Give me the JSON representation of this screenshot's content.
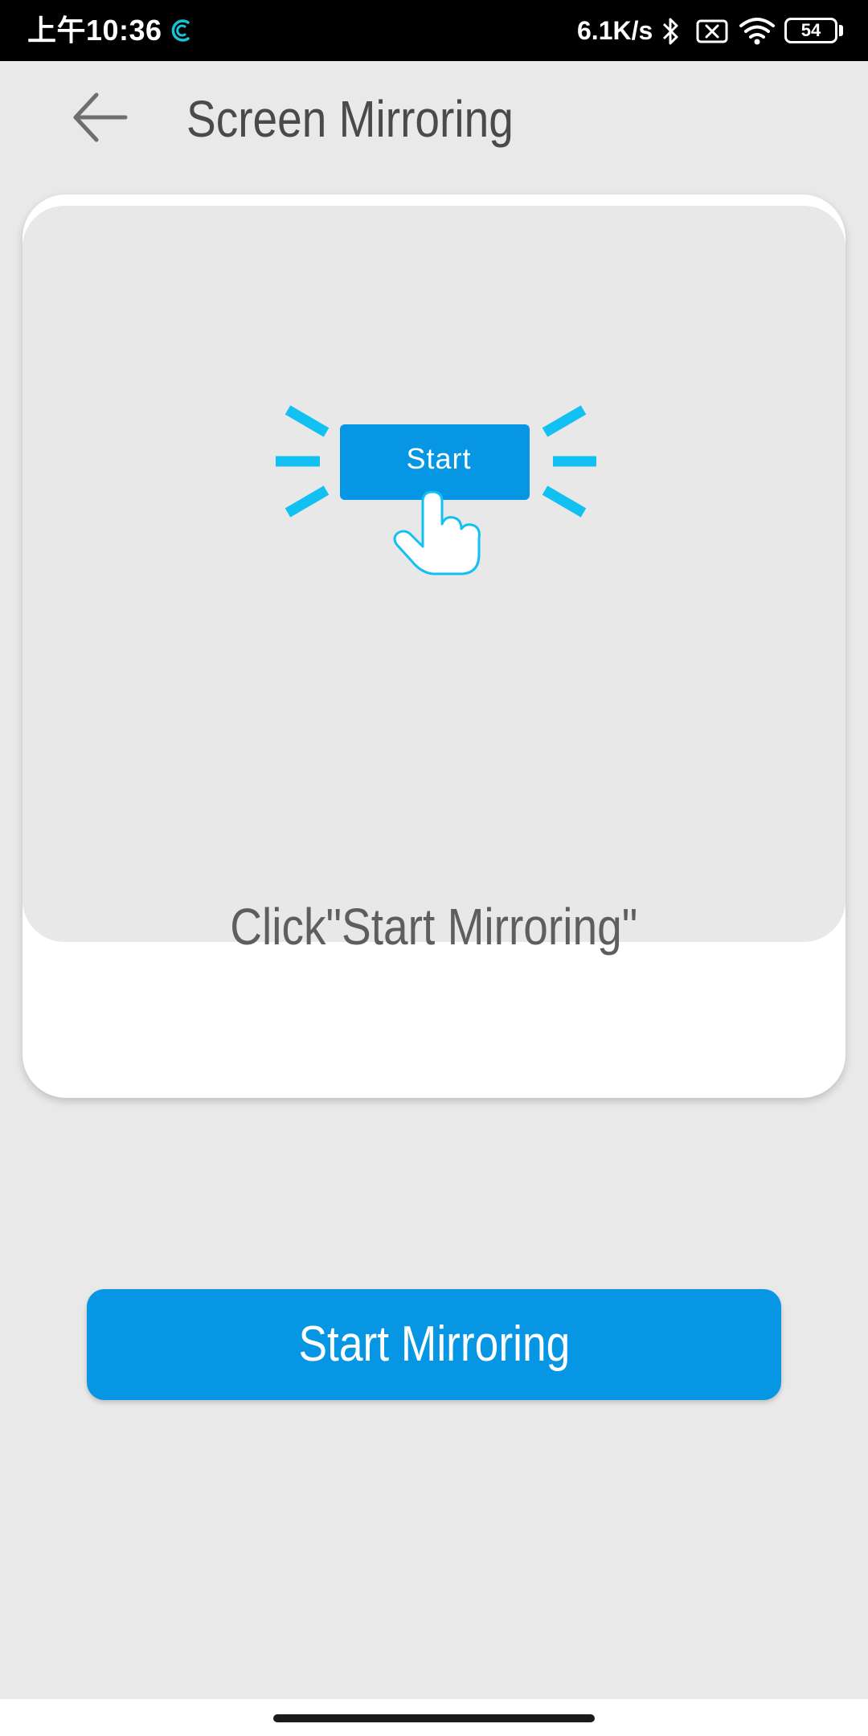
{
  "status_bar": {
    "time": "上午10:36",
    "network_speed": "6.1K/s",
    "battery_level": "54",
    "icons": [
      "app-notification-icon",
      "bluetooth-icon",
      "no-sim-icon",
      "wifi-icon",
      "battery-icon"
    ]
  },
  "header": {
    "back_icon": "arrow-left-icon",
    "title": "Screen Mirroring"
  },
  "card": {
    "illustration": {
      "button_label": "Start",
      "icon": "hand-pointer-icon"
    },
    "instruction": "Click\"Start Mirroring\""
  },
  "primary_action": {
    "label": "Start Mirroring"
  },
  "colors": {
    "accent": "#0796e4",
    "highlight": "#12c0f2",
    "background": "#e9e9e9",
    "card": "#ffffff",
    "title_text": "#4a4a4a"
  }
}
